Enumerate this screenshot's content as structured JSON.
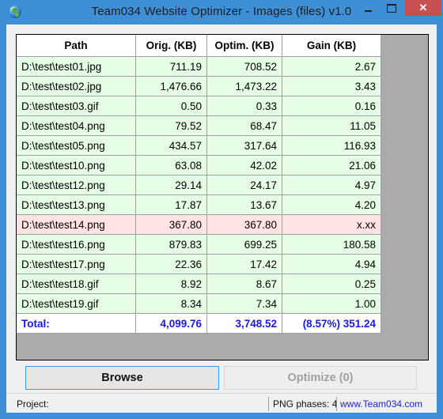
{
  "window": {
    "title": "Team034 Website Optimizer - Images (files) v1.0",
    "icons": {
      "app": "globe-icon",
      "minimize": "minimize-icon",
      "maximize": "maximize-icon",
      "close": "close-icon"
    },
    "close_glyph": "✕"
  },
  "grid": {
    "columns": [
      "Path",
      "Orig. (KB)",
      "Optim. (KB)",
      "Gain (KB)"
    ],
    "rows": [
      {
        "path": "D:\\test\\test01.jpg",
        "orig": "711.19",
        "optim": "708.52",
        "gain": "2.67",
        "status": "ok"
      },
      {
        "path": "D:\\test\\test02.jpg",
        "orig": "1,476.66",
        "optim": "1,473.22",
        "gain": "3.43",
        "status": "ok"
      },
      {
        "path": "D:\\test\\test03.gif",
        "orig": "0.50",
        "optim": "0.33",
        "gain": "0.16",
        "status": "ok"
      },
      {
        "path": "D:\\test\\test04.png",
        "orig": "79.52",
        "optim": "68.47",
        "gain": "11.05",
        "status": "ok"
      },
      {
        "path": "D:\\test\\test05.png",
        "orig": "434.57",
        "optim": "317.64",
        "gain": "116.93",
        "status": "ok"
      },
      {
        "path": "D:\\test\\test10.png",
        "orig": "63.08",
        "optim": "42.02",
        "gain": "21.06",
        "status": "ok"
      },
      {
        "path": "D:\\test\\test12.png",
        "orig": "29.14",
        "optim": "24.17",
        "gain": "4.97",
        "status": "ok"
      },
      {
        "path": "D:\\test\\test13.png",
        "orig": "17.87",
        "optim": "13.67",
        "gain": "4.20",
        "status": "ok"
      },
      {
        "path": "D:\\test\\test14.png",
        "orig": "367.80",
        "optim": "367.80",
        "gain": "x.xx",
        "status": "error"
      },
      {
        "path": "D:\\test\\test16.png",
        "orig": "879.83",
        "optim": "699.25",
        "gain": "180.58",
        "status": "ok"
      },
      {
        "path": "D:\\test\\test17.png",
        "orig": "22.36",
        "optim": "17.42",
        "gain": "4.94",
        "status": "ok"
      },
      {
        "path": "D:\\test\\test18.gif",
        "orig": "8.92",
        "optim": "8.67",
        "gain": "0.25",
        "status": "ok"
      },
      {
        "path": "D:\\test\\test19.gif",
        "orig": "8.34",
        "optim": "7.34",
        "gain": "1.00",
        "status": "ok"
      }
    ],
    "total": {
      "label": "Total:",
      "orig": "4,099.76",
      "optim": "3,748.52",
      "gain": "(8.57%) 351.24"
    },
    "colors": {
      "ok_row": "#e5fce5",
      "error_row": "#ffe3e3",
      "total_text": "#1a1adc"
    }
  },
  "buttons": {
    "browse": "Browse",
    "optimize": "Optimize (0)"
  },
  "status": {
    "project_label": "Project:",
    "png_phases": "PNG phases: 4",
    "link": "www.Team034.com"
  }
}
